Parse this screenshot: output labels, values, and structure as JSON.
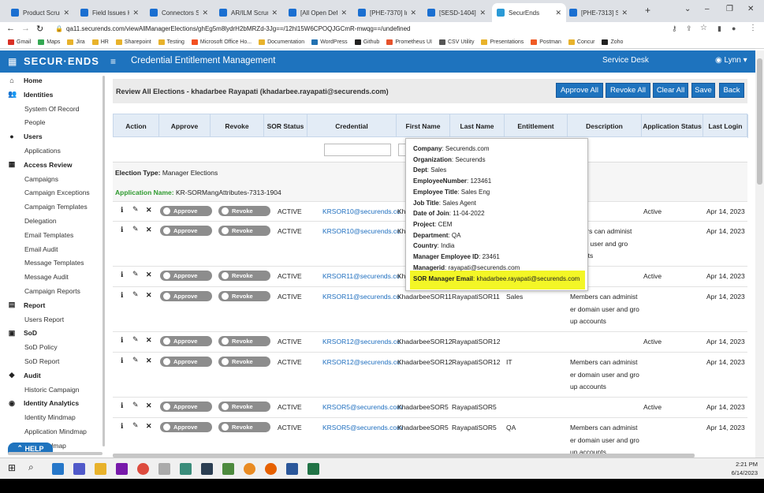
{
  "browser": {
    "tabs": [
      {
        "title": "Product Scrum B…",
        "color": "#1a6fd1"
      },
      {
        "title": "Field Issues Kanb…",
        "color": "#1a6fd1"
      },
      {
        "title": "Connectors Scrum…",
        "color": "#1a6fd1"
      },
      {
        "title": "AR/ILM Scrum B…",
        "color": "#1a6fd1"
      },
      {
        "title": "[All Open Defect…",
        "color": "#1a6fd1"
      },
      {
        "title": "[PHE-7370] Inde…",
        "color": "#1a6fd1"
      },
      {
        "title": "[SESD-1404] Lum…",
        "color": "#1a6fd1"
      },
      {
        "title": "SecurEnds",
        "color": "#2a9ad6"
      },
      {
        "title": "[PHE-7313] SOR…",
        "color": "#1a6fd1"
      }
    ],
    "url": "qa11.securends.com/viewAllManagerElections/ghEg5m8lydrH2bMRZd-3Jg==/12hl15W6CPOQJGCmR-mwqg==/undefined",
    "bookmarks": [
      "Gmail",
      "Maps",
      "Jira",
      "HR",
      "Sharepoint",
      "Testing",
      "Microsoft Office Ho...",
      "Documentation",
      "WordPress",
      "Github",
      "Prometheus UI",
      "CSV Utility",
      "Presentations",
      "Postman",
      "Concur",
      "Zoho"
    ]
  },
  "header": {
    "logo": "SECUR·ENDS",
    "title": "Credential Entitlement Management",
    "service_desk": "Service Desk",
    "user": "Lynn"
  },
  "sidebar": [
    {
      "label": "Home",
      "type": "sec",
      "icon": "home-icon",
      "glyph": "⌂"
    },
    {
      "label": "Identities",
      "type": "sec",
      "icon": "users-icon",
      "glyph": "👥"
    },
    {
      "label": "System Of Record",
      "type": "sub"
    },
    {
      "label": "People",
      "type": "sub"
    },
    {
      "label": "Users",
      "type": "sec",
      "icon": "user-icon",
      "glyph": "●"
    },
    {
      "label": "Applications",
      "type": "sub"
    },
    {
      "label": "Access Review",
      "type": "sec",
      "icon": "grid-icon",
      "glyph": "▦"
    },
    {
      "label": "Campaigns",
      "type": "sub"
    },
    {
      "label": "Campaign Exceptions",
      "type": "sub"
    },
    {
      "label": "Campaign Templates",
      "type": "sub"
    },
    {
      "label": "Delegation",
      "type": "sub"
    },
    {
      "label": "Email Templates",
      "type": "sub"
    },
    {
      "label": "Email Audit",
      "type": "sub"
    },
    {
      "label": "Message Templates",
      "type": "sub"
    },
    {
      "label": "Message Audit",
      "type": "sub"
    },
    {
      "label": "Campaign Reports",
      "type": "sub"
    },
    {
      "label": "Report",
      "type": "sec",
      "icon": "report-icon",
      "glyph": "▤"
    },
    {
      "label": "Users Report",
      "type": "sub"
    },
    {
      "label": "SoD",
      "type": "sec",
      "icon": "sod-icon",
      "glyph": "▣"
    },
    {
      "label": "SoD Policy",
      "type": "sub"
    },
    {
      "label": "SoD Report",
      "type": "sub"
    },
    {
      "label": "Audit",
      "type": "sec",
      "icon": "shield-icon",
      "glyph": "◆"
    },
    {
      "label": "Historic Campaign",
      "type": "sub"
    },
    {
      "label": "Identity Analytics",
      "type": "sec",
      "icon": "analytics-icon",
      "glyph": "◉"
    },
    {
      "label": "Identity Mindmap",
      "type": "sub"
    },
    {
      "label": "Application Mindmap",
      "type": "sub"
    },
    {
      "label": "…nt Mindmap",
      "type": "sub"
    }
  ],
  "help": "HELP",
  "review": {
    "title": "Review All Elections - khadarbee Rayapati (khadarbee.rayapati@securends.com)",
    "buttons": [
      "Approve All",
      "Revoke All",
      "Clear All",
      "Save",
      "Back"
    ],
    "columns": [
      "Action",
      "Approve",
      "Revoke",
      "SOR Status",
      "Credential",
      "First Name",
      "Last Name",
      "Entitlement",
      "Description",
      "Application Status",
      "Last Login"
    ],
    "election_type_label": "Election Type:",
    "election_type": "Manager Elections",
    "application_name_label": "Application Name:",
    "application_name": "KR-SORMangAttributes-7313-1904",
    "approve_label": "Approve",
    "revoke_label": "Revoke",
    "rows": [
      {
        "status": "ACTIVE",
        "credential": "KRSOR10@securends.co",
        "first": "Kh",
        "last": "",
        "entitlement": "",
        "description": [],
        "app_status": "Active",
        "last_login": "Apr 14, 2023"
      },
      {
        "status": "ACTIVE",
        "credential": "KRSOR10@securends.co",
        "first": "Khad",
        "last": "",
        "entitlement": "",
        "description": [
          "embers can administ",
          "omain user and gro",
          "ccounts"
        ],
        "app_status": "",
        "last_login": "Apr 14, 2023"
      },
      {
        "status": "ACTIVE",
        "credential": "KRSOR11@securends.co",
        "first": "Kh",
        "last": "",
        "entitlement": "",
        "description": [],
        "app_status": "Active",
        "last_login": "Apr 14, 2023"
      },
      {
        "status": "ACTIVE",
        "credential": "KRSOR11@securends.co",
        "first": "KhadarbeeSOR11",
        "last": "RayapatiSOR11",
        "entitlement": "Sales",
        "description": [
          "Members can administ",
          "er domain user and gro",
          "up accounts"
        ],
        "app_status": "",
        "last_login": "Apr 14, 2023"
      },
      {
        "status": "ACTIVE",
        "credential": "KRSOR12@securends.co",
        "first": "KhadarbeeSOR12",
        "last": "RayapatiSOR12",
        "entitlement": "",
        "description": [],
        "app_status": "Active",
        "last_login": "Apr 14, 2023"
      },
      {
        "status": "ACTIVE",
        "credential": "KRSOR12@securends.co",
        "first": "KhadarbeeSOR12",
        "last": "RayapatiSOR12",
        "entitlement": "IT",
        "description": [
          "Members can administ",
          "er domain user and gro",
          "up accounts"
        ],
        "app_status": "",
        "last_login": "Apr 14, 2023"
      },
      {
        "status": "ACTIVE",
        "credential": "KRSOR5@securends.com",
        "first": "KhadarbeeSOR5",
        "last": "RayapatiSOR5",
        "entitlement": "",
        "description": [],
        "app_status": "Active",
        "last_login": "Apr 14, 2023"
      },
      {
        "status": "ACTIVE",
        "credential": "KRSOR5@securends.com",
        "first": "KhadarbeeSOR5",
        "last": "RayapatiSOR5",
        "entitlement": "QA",
        "description": [
          "Members can administ",
          "er domain user and gro",
          "up accounts"
        ],
        "app_status": "",
        "last_login": "Apr 14, 2023"
      }
    ]
  },
  "popup": [
    {
      "k": "Company",
      "v": "Securends.com"
    },
    {
      "k": "Organization",
      "v": "Securends"
    },
    {
      "k": "Dept",
      "v": "Sales"
    },
    {
      "k": "EmployeeNumber",
      "v": "123461"
    },
    {
      "k": "Employee Title",
      "v": "Sales Eng"
    },
    {
      "k": "Job Title",
      "v": "Sales Agent"
    },
    {
      "k": "Date of Join",
      "v": "11-04-2022"
    },
    {
      "k": "Project",
      "v": "CEM"
    },
    {
      "k": "Department",
      "v": "QA"
    },
    {
      "k": "Country",
      "v": "India"
    },
    {
      "k": "Manager Employee ID",
      "v": "23461"
    },
    {
      "k": "Managerid",
      "v": "rayapati@securends.com"
    },
    {
      "k": "SOR Manager Email",
      "v": "khadarbee.rayapati@securends.com"
    }
  ],
  "taskbar": {
    "time": "2:21 PM",
    "date": "6/14/2023"
  }
}
